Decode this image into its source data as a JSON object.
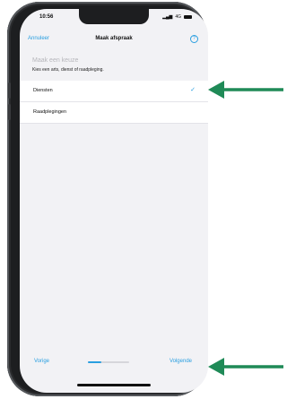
{
  "status_bar": {
    "time": "10:56",
    "signal_text": "4G"
  },
  "nav": {
    "cancel_label": "Annuleer",
    "title": "Maak afspraak",
    "help_icon": "help-circle-icon",
    "help_glyph": "?"
  },
  "content": {
    "heading": "Maak een keuze",
    "subheading": "Kies een arts, dienst of raadpleging."
  },
  "options": [
    {
      "label": "Diensten",
      "selected": true
    },
    {
      "label": "Raadplegingen",
      "selected": false
    }
  ],
  "checkmark": "✓",
  "footer": {
    "previous_label": "Vorige",
    "next_label": "Volgende",
    "progress_fraction": 0.33
  },
  "colors": {
    "accent": "#2a9fe0",
    "arrow": "#1f8a57"
  }
}
